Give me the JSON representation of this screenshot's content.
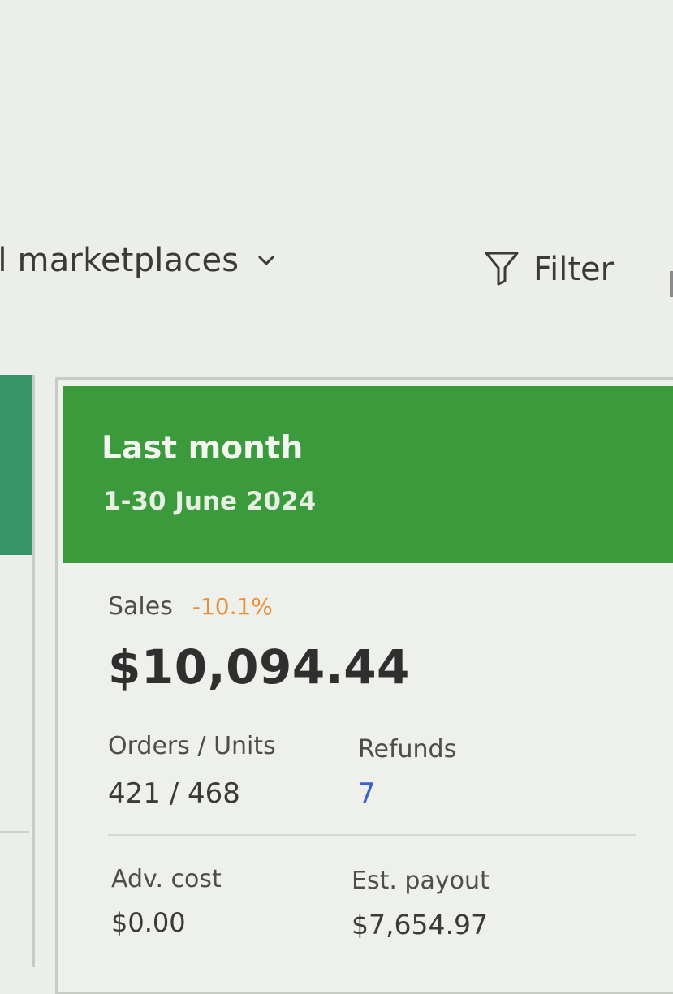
{
  "toolbar": {
    "marketplace_label": "ll marketplaces",
    "filter_label": "Filter"
  },
  "card": {
    "period_title": "Last month",
    "period_range": "1-30 June 2024",
    "sales": {
      "label": "Sales",
      "change": "-10.1%",
      "amount": "$10,094.44"
    },
    "orders_units": {
      "label": "Orders / Units",
      "value": "421 / 468"
    },
    "refunds": {
      "label": "Refunds",
      "value": "7"
    },
    "adv_cost": {
      "label": "Adv. cost",
      "value": "$0.00"
    },
    "est_payout": {
      "label": "Est. payout",
      "value": "$7,654.97"
    }
  },
  "colors": {
    "header_green": "#3a9a3c",
    "neighbor_header_teal": "#359566",
    "change_negative": "#e8903a",
    "link_blue": "#3b5fd1"
  },
  "icons": {
    "chevron": "chevron-down-icon",
    "filter": "filter-icon"
  }
}
